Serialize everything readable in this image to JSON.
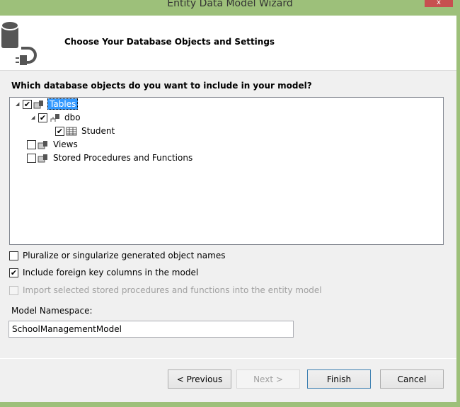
{
  "window": {
    "title": "Entity Data Model Wizard",
    "close_label": "x"
  },
  "header": {
    "title": "Choose Your Database Objects and Settings"
  },
  "question": "Which database objects do you want to include in your model?",
  "tree": [
    {
      "label": "Tables",
      "checked": true,
      "expanded": true,
      "selected": true
    },
    {
      "label": "dbo",
      "checked": true,
      "expanded": true
    },
    {
      "label": "Student",
      "checked": true
    },
    {
      "label": "Views",
      "checked": false
    },
    {
      "label": "Stored Procedures and Functions",
      "checked": false
    }
  ],
  "options": [
    {
      "label": "Pluralize or singularize generated object names",
      "checked": false,
      "enabled": true
    },
    {
      "label": "Include foreign key columns in the model",
      "checked": true,
      "enabled": true
    },
    {
      "label": "Import selected stored procedures and functions into the entity model",
      "checked": false,
      "enabled": false
    }
  ],
  "namespace": {
    "label": "Model Namespace:",
    "value": "SchoolManagementModel"
  },
  "buttons": {
    "previous": "< Previous",
    "next": "Next >",
    "finish": "Finish",
    "cancel": "Cancel"
  },
  "checkmark": "✔"
}
